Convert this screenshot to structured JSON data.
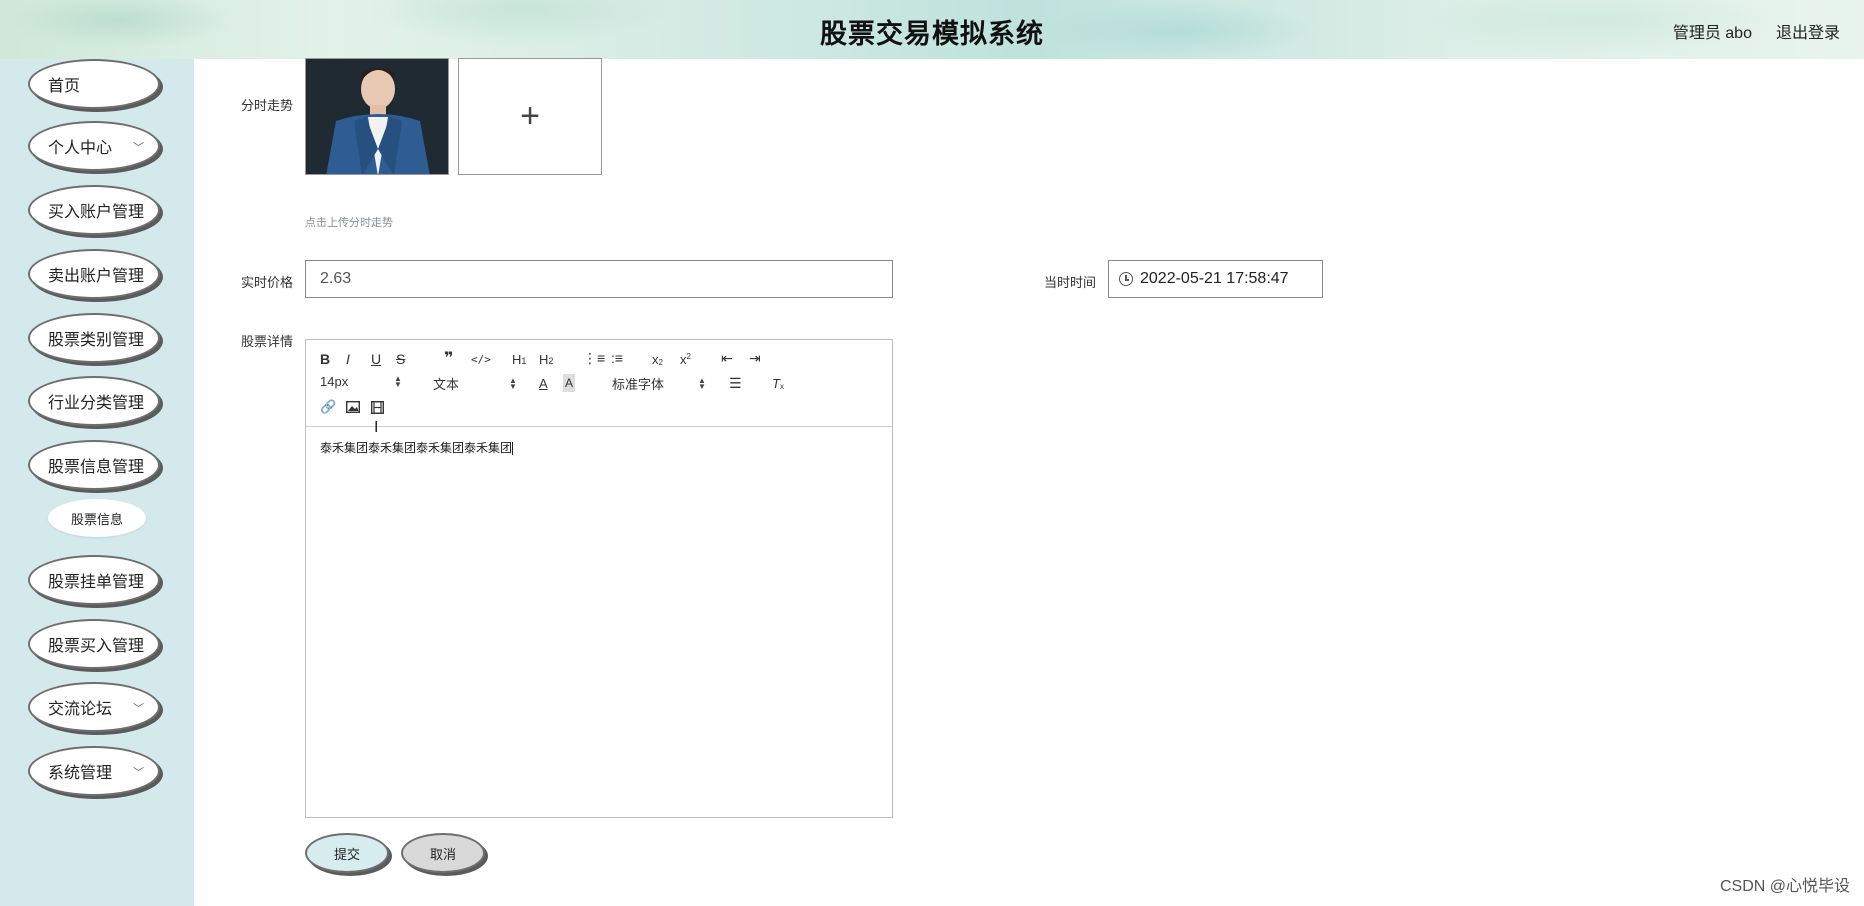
{
  "header": {
    "title": "股票交易模拟系统",
    "user_label": "管理员 abo",
    "logout_label": "退出登录"
  },
  "sidebar": {
    "items": [
      {
        "label": "首页",
        "has_submenu": false
      },
      {
        "label": "个人中心",
        "has_submenu": true
      },
      {
        "label": "买入账户管理",
        "has_submenu": true
      },
      {
        "label": "卖出账户管理",
        "has_submenu": true
      },
      {
        "label": "股票类别管理",
        "has_submenu": true
      },
      {
        "label": "行业分类管理",
        "has_submenu": true
      },
      {
        "label": "股票信息管理",
        "has_submenu": true
      },
      {
        "label": "股票挂单管理",
        "has_submenu": true
      },
      {
        "label": "股票买入管理",
        "has_submenu": true
      },
      {
        "label": "交流论坛",
        "has_submenu": true
      },
      {
        "label": "系统管理",
        "has_submenu": true
      }
    ],
    "sub_item": "股票信息"
  },
  "form": {
    "trend_label": "分时走势",
    "upload_hint": "点击上传分时走势",
    "upload_icon": "plus-icon",
    "price_label": "实时价格",
    "price_value": "2.63",
    "time_label": "当时时间",
    "time_value": "2022-05-21 17:58:47",
    "detail_label": "股票详情"
  },
  "editor": {
    "font_size": "14px",
    "block_format": "文本",
    "font_family": "标准字体",
    "content": "泰禾集团泰禾集团泰禾集团泰禾集团"
  },
  "actions": {
    "submit": "提交",
    "cancel": "取消",
    "submit_color": "#d6ecef",
    "cancel_color": "#d9d9d9"
  },
  "watermark": "CSDN @心悦毕设"
}
